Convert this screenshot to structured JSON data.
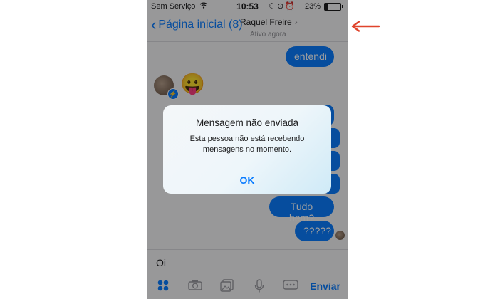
{
  "status_bar": {
    "carrier": "Sem Serviço",
    "time": "10:53",
    "battery_percent": "23%",
    "battery_level": 0.23,
    "icons": [
      "wifi-icon",
      "moon-icon",
      "orientation-lock-icon",
      "alarm-icon",
      "battery-icon"
    ]
  },
  "nav": {
    "back_label": "Página inicial (8)",
    "contact_name": "Raquel Freire",
    "contact_status": "Ativo agora"
  },
  "messages": {
    "m1": "entendi",
    "m2": "Tudo bem?",
    "m3": "?????",
    "emoji": "😛"
  },
  "composer": {
    "draft": "Oi",
    "send_label": "Enviar"
  },
  "alert": {
    "title": "Mensagem não enviada",
    "message": "Esta pessoa não está recebendo mensagens no momento.",
    "ok_label": "OK"
  },
  "colors": {
    "accent": "#0a7cff",
    "annotation_arrow": "#e0442c"
  }
}
